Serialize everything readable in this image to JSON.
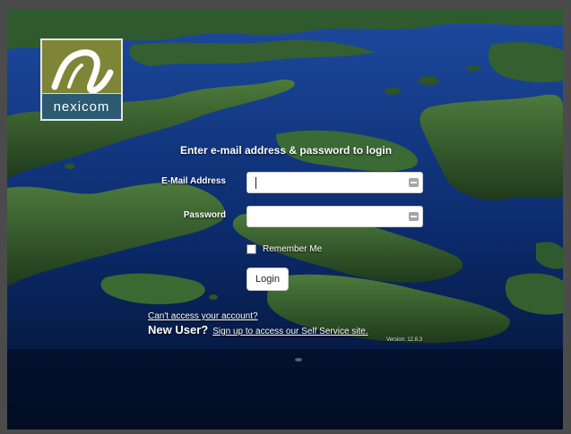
{
  "logo": {
    "text": "nexicom"
  },
  "login": {
    "heading": "Enter e-mail address & password to login",
    "email_label": "E-Mail Address",
    "email_value": "",
    "password_label": "Password",
    "password_value": "",
    "remember_label": "Remember Me",
    "remember_checked": false,
    "login_button": "Login"
  },
  "links": {
    "cant_access": "Can't access your account?",
    "new_user_label": "New User?",
    "signup": "Sign up to access our Self Service site."
  },
  "version": "Version: 12.8.3",
  "colors": {
    "logo_olive": "#7e8536",
    "logo_band": "#2b5a72",
    "water": "#0b2a66",
    "page_frame": "#4b4b4b"
  }
}
